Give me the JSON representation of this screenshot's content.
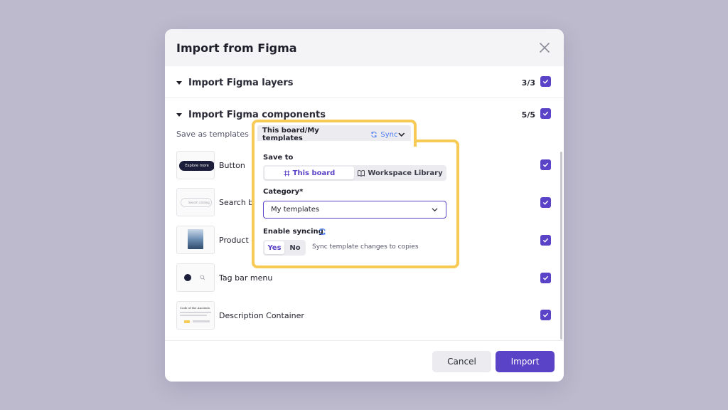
{
  "dialog": {
    "title": "Import from Figma",
    "cancel_label": "Cancel",
    "import_label": "Import"
  },
  "sections": {
    "layers": {
      "title": "Import Figma layers",
      "count": "3/3"
    },
    "components": {
      "title": "Import Figma components",
      "count": "5/5"
    }
  },
  "save_as_label": "Save as templates in",
  "components": [
    {
      "name": "Button",
      "thumb_text": "Explore more"
    },
    {
      "name": "Search bo",
      "thumb_text": "Search catalog"
    },
    {
      "name": "Product c"
    },
    {
      "name": "Tag bar menu"
    },
    {
      "name": "Description Container",
      "thumb_text": "Code of the Ancients"
    }
  ],
  "popover": {
    "tab_label": "This board/My templates",
    "sync_label": "Sync",
    "save_to_label": "Save to",
    "save_to_options": [
      "This board",
      "Workspace Library"
    ],
    "save_to_selected": "This board",
    "category_label": "Category*",
    "category_value": "My templates",
    "sync_section_label": "Enable syncing",
    "yes_label": "Yes",
    "no_label": "No",
    "sync_hint": "Sync template changes to copies"
  },
  "colors": {
    "accent": "#5b43c7",
    "highlight": "#f7c955",
    "sync_blue": "#4a7df0",
    "background": "#bdbacd"
  }
}
